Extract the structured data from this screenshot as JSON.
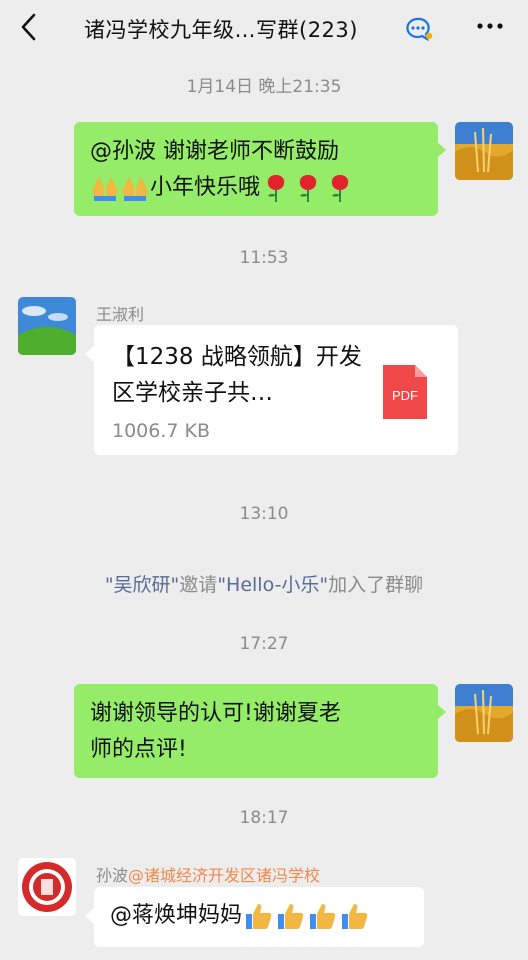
{
  "header": {
    "title": "诸冯学校九年级…写群(223)",
    "icons": [
      "back-chevron-icon",
      "chat-group-icon",
      "more-dots-icon"
    ]
  },
  "messages": {
    "ts1": "1月14日 晚上21:35",
    "m1_line1": "@孙波  谢谢老师不断鼓励",
    "m1_line2": "小年快乐哦",
    "ts2": "11:53",
    "m2_sender": "王淑利",
    "m2_file_name": "【1238 战略领航】开发区学校亲子共…",
    "m2_file_size": "1006.7 KB",
    "m2_file_type": "PDF",
    "ts3": "13:10",
    "sys_invitee": "\"吴欣研\"",
    "sys_invite_word": "邀请",
    "sys_new_member": "\"Hello-小乐\"",
    "sys_join_text": "加入了群聊",
    "ts4": "17:27",
    "m3_line1": "谢谢领导的认可!谢谢夏老",
    "m3_line2": "师的点评!",
    "ts5": "18:17",
    "m4_sender": "孙波",
    "m4_sender_tag": "@诸城经济开发区诸冯学校",
    "m4_text": "@蒋焕坤妈妈"
  },
  "colors": {
    "background": "#ededed",
    "green_bubble": "#95ec69",
    "pdf_red": "#f04848",
    "system_name": "#576b95",
    "sender_tag": "#f0894a"
  }
}
